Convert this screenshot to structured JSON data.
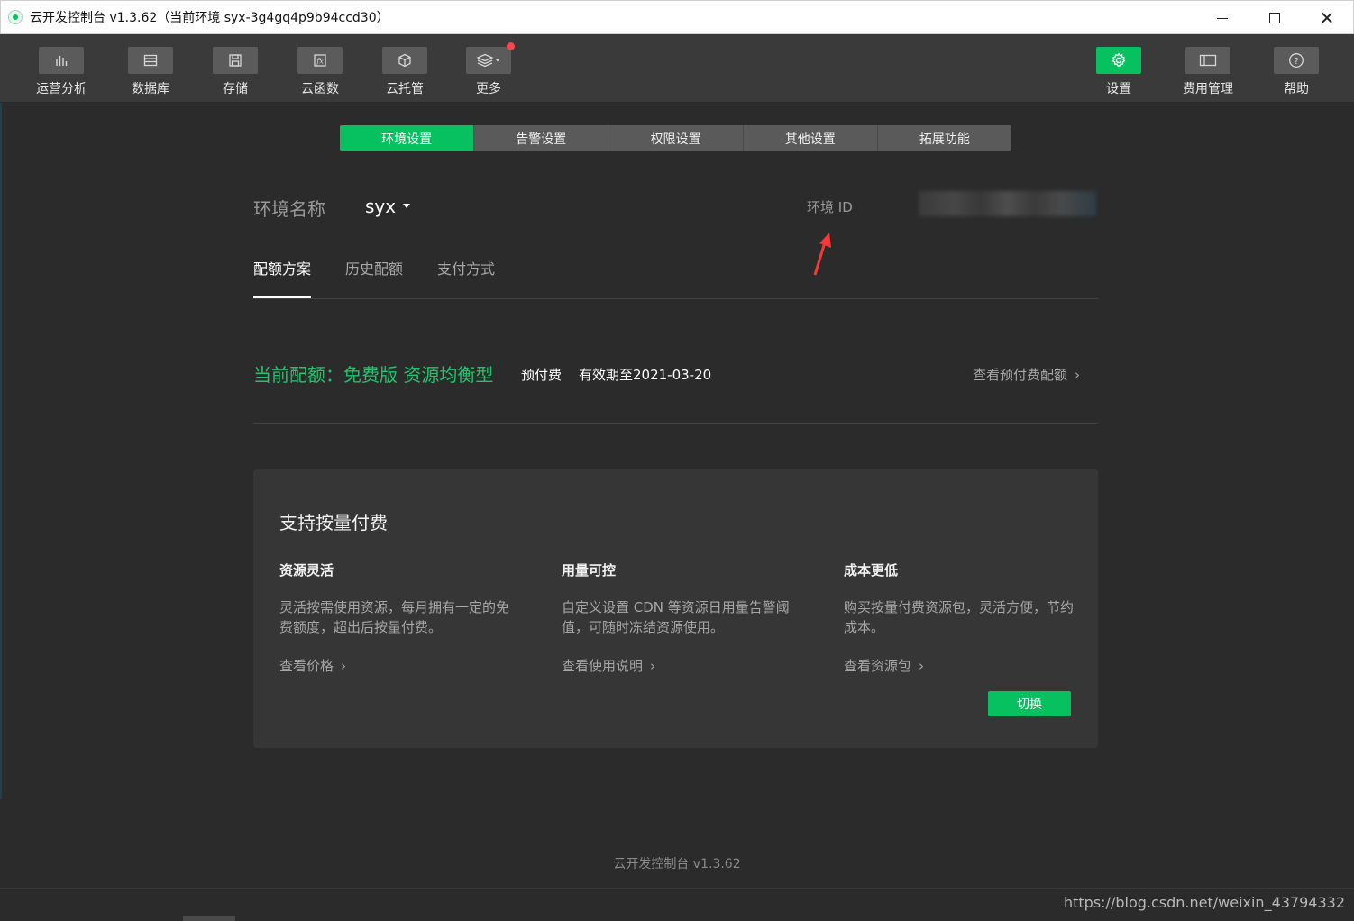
{
  "window": {
    "title": "云开发控制台 v1.3.62（当前环境 syx-3g4gq4p9b94ccd30）"
  },
  "toolbar": {
    "left": [
      {
        "label": "运营分析",
        "icon": "bar-chart-icon"
      },
      {
        "label": "数据库",
        "icon": "database-icon"
      },
      {
        "label": "存储",
        "icon": "storage-icon"
      },
      {
        "label": "云函数",
        "icon": "function-icon"
      },
      {
        "label": "云托管",
        "icon": "cube-icon"
      },
      {
        "label": "更多",
        "icon": "layers-icon"
      }
    ],
    "right": [
      {
        "label": "设置",
        "icon": "gear-icon"
      },
      {
        "label": "费用管理",
        "icon": "billing-icon"
      },
      {
        "label": "帮助",
        "icon": "help-icon"
      }
    ]
  },
  "tabs": [
    "环境设置",
    "告警设置",
    "权限设置",
    "其他设置",
    "拓展功能"
  ],
  "env": {
    "name_label": "环境名称",
    "name_value": "syx",
    "id_label": "环境 ID"
  },
  "subtabs": [
    "配额方案",
    "历史配额",
    "支付方式"
  ],
  "quota": {
    "title": "当前配额：免费版 资源均衡型",
    "prepaid": "预付费",
    "expiry": "有效期至2021-03-20",
    "link": "查看预付费配额"
  },
  "card": {
    "title": "支持按量付费",
    "features": [
      {
        "title": "资源灵活",
        "desc": "灵活按需使用资源，每月拥有一定的免费额度，超出后按量付费。",
        "link": "查看价格"
      },
      {
        "title": "用量可控",
        "desc": "自定义设置 CDN 等资源日用量告警阈值，可随时冻结资源使用。",
        "link": "查看使用说明"
      },
      {
        "title": "成本更低",
        "desc": "购买按量付费资源包，灵活方便，节约成本。",
        "link": "查看资源包"
      }
    ],
    "switch_label": "切换"
  },
  "footer": {
    "version": "云开发控制台 v1.3.62"
  },
  "watermark": "https://blog.csdn.net/weixin_43794332",
  "colors": {
    "accent": "#07c160",
    "background": "#2b2b2b",
    "notification": "#f24a4a"
  }
}
